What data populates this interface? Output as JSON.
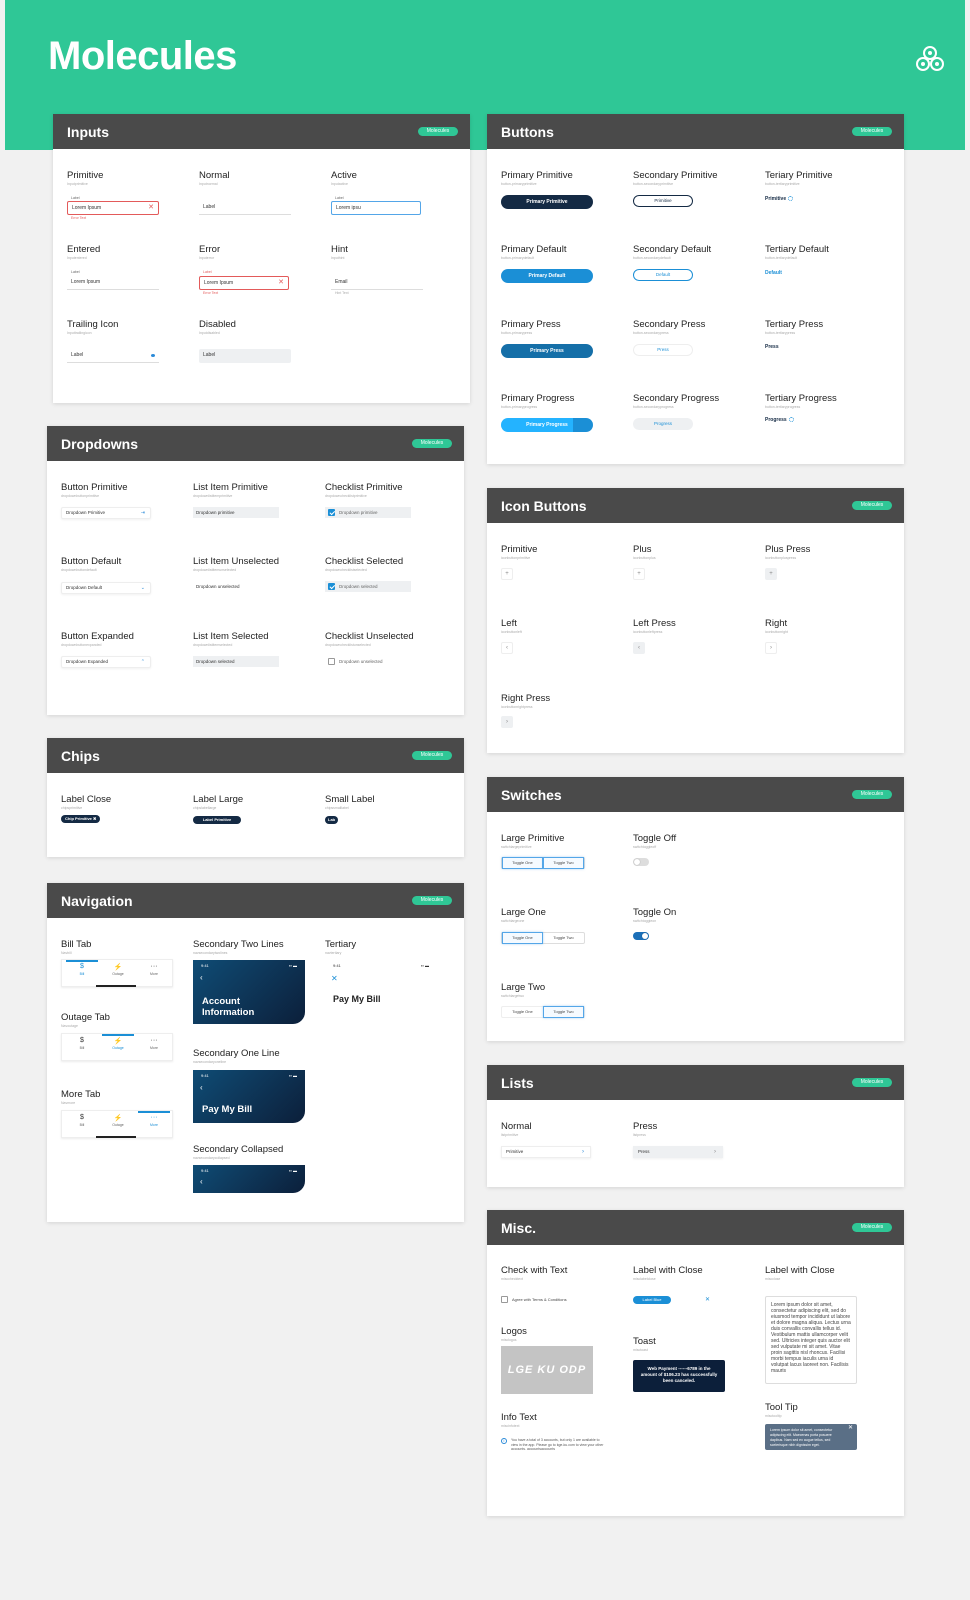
{
  "header": {
    "title": "Molecules",
    "logo": "trefoil-logo-icon"
  },
  "badge": "Molecules",
  "inputs": {
    "title": "Inputs",
    "primitive": {
      "label": "Primitive",
      "sub": "Inputprimitive",
      "float": "Label",
      "value": "Lorem Ipsum",
      "helper": "Error Text"
    },
    "normal": {
      "label": "Normal",
      "sub": "Inputnormal",
      "value": "Label"
    },
    "active": {
      "label": "Active",
      "sub": "Inputactive",
      "float": "Label",
      "value": "Lorem ipsu"
    },
    "entered": {
      "label": "Entered",
      "sub": "Inputentered",
      "float": "Label",
      "value": "Lorem Ipsum"
    },
    "error": {
      "label": "Error",
      "sub": "Inputerror",
      "float": "Label",
      "value": "Lorem Ipsum",
      "helper": "Error Text"
    },
    "hint": {
      "label": "Hint",
      "sub": "Inputhint",
      "value": "Email",
      "helper": "Hint Text"
    },
    "trailing": {
      "label": "Trailing Icon",
      "sub": "Inputtrailingicon",
      "value": "Label"
    },
    "disabled": {
      "label": "Disabled",
      "sub": "Inputdisabled",
      "value": "Label"
    }
  },
  "buttons": {
    "title": "Buttons",
    "pp": {
      "label": "Primary Primitive",
      "sub": "button-primaryprimitive",
      "btn": "Primary Primitive"
    },
    "sp": {
      "label": "Secondary Primitive",
      "sub": "button-secondaryprimitive",
      "btn": "Primitive"
    },
    "tp": {
      "label": "Teriary Primitive",
      "sub": "button-tertiaryprimitive",
      "btn": "Primitive"
    },
    "pd": {
      "label": "Primary Default",
      "sub": "button-primarydefault",
      "btn": "Primary Default"
    },
    "sd": {
      "label": "Secondary Default",
      "sub": "button-secondarydefault",
      "btn": "Default"
    },
    "td": {
      "label": "Tertiary Default",
      "sub": "button-tertiarydefault",
      "btn": "Default"
    },
    "ppr": {
      "label": "Primary Press",
      "sub": "button-primarypress",
      "btn": "Primary Press"
    },
    "spr": {
      "label": "Secondary Press",
      "sub": "button-secondarypress",
      "btn": "Press"
    },
    "tpr": {
      "label": "Tertiary Press",
      "sub": "button-tertiarypress",
      "btn": "Press"
    },
    "pg": {
      "label": "Primary Progress",
      "sub": "button-primaryprogress",
      "btn": "Primary Progress"
    },
    "sg": {
      "label": "Secondary Progress",
      "sub": "button-secondaryprogress",
      "btn": "Progress"
    },
    "tg": {
      "label": "Tertiary Progress",
      "sub": "button-tertiaryprogress",
      "btn": "Progress"
    }
  },
  "dropdowns": {
    "title": "Dropdowns",
    "bp": {
      "label": "Button Primitive",
      "sub": "dropdownbuttonprimitive",
      "value": "Dropdown Primitive"
    },
    "lp": {
      "label": "List Item Primitive",
      "sub": "dropdownlistitemprimitive",
      "value": "Dropdown primitive"
    },
    "cp": {
      "label": "Checklist Primitive",
      "sub": "dropdownchecklistprimitive",
      "value": "Dropdown primitive"
    },
    "bd": {
      "label": "Button Default",
      "sub": "dropdownbuttondefault",
      "value": "Dropdown Default"
    },
    "lu": {
      "label": "List Item Unselected",
      "sub": "dropdownlistitemunselected",
      "value": "Dropdown unselected"
    },
    "cs": {
      "label": "Checklist Selected",
      "sub": "dropdownchecklistselected",
      "value": "Dropdown selected"
    },
    "be": {
      "label": "Button Expanded",
      "sub": "dropdownbuttonexpanded",
      "value": "Dropdown Expanded"
    },
    "ls": {
      "label": "List Item Selected",
      "sub": "dropdownlistitemselected",
      "value": "Dropdown selected"
    },
    "cu": {
      "label": "Checklist Unselected",
      "sub": "dropdownchecklistunselected",
      "value": "Dropdown unselected"
    }
  },
  "iconButtons": {
    "title": "Icon Buttons",
    "prim": {
      "label": "Primitive",
      "sub": "iconbuttonprimitive"
    },
    "plus": {
      "label": "Plus",
      "sub": "iconbuttonplus"
    },
    "plusp": {
      "label": "Plus Press",
      "sub": "iconbuttonpluspress"
    },
    "left": {
      "label": "Left",
      "sub": "iconbuttonleft"
    },
    "leftp": {
      "label": "Left Press",
      "sub": "iconbuttonleftpress"
    },
    "right": {
      "label": "Right",
      "sub": "iconbuttonright"
    },
    "rightp": {
      "label": "Right Press",
      "sub": "iconbuttonrightpress"
    }
  },
  "chips": {
    "title": "Chips",
    "lc": {
      "label": "Label Close",
      "sub": "chipsprimitive",
      "chip": "Chip Primitive"
    },
    "ll": {
      "label": "Label Large",
      "sub": "chipslabellarge",
      "chip": "Label Primitive"
    },
    "sl": {
      "label": "Small Label",
      "sub": "chipssmalllabel",
      "chip": "Lab"
    }
  },
  "switches": {
    "title": "Switches",
    "lp": {
      "label": "Large Primitive",
      "sub": "switchlargeprimitive"
    },
    "toff": {
      "label": "Toggle Off",
      "sub": "switchtoggleoff"
    },
    "lo": {
      "label": "Large One",
      "sub": "switchlargeone"
    },
    "ton": {
      "label": "Toggle On",
      "sub": "switchtoggleon"
    },
    "lt": {
      "label": "Large Two",
      "sub": "switchlargetwo"
    },
    "one": "Toggle One",
    "two": "Toggle Two"
  },
  "navigation": {
    "title": "Navigation",
    "bill": {
      "label": "Bill Tab",
      "sub": "Navbill"
    },
    "outage": {
      "label": "Outage Tab",
      "sub": "Navoutage"
    },
    "more": {
      "label": "More Tab",
      "sub": "Navmore"
    },
    "tabs": [
      "Bill",
      "Outage",
      "More"
    ],
    "s2": {
      "label": "Secondary Two Lines",
      "sub": "navsecondarytwolines",
      "title": "Account Information"
    },
    "s1": {
      "label": "Secondary One Line",
      "sub": "navsecondaryoneline",
      "title": "Pay My Bill"
    },
    "sc": {
      "label": "Secondary Collapsed",
      "sub": "navsecondarycollapsed"
    },
    "tert": {
      "label": "Tertiary",
      "sub": "navtertiary",
      "title": "Pay My Bill"
    },
    "time": "9:41"
  },
  "lists": {
    "title": "Lists",
    "normal": {
      "label": "Normal",
      "sub": "listprimitive",
      "value": "Primitive"
    },
    "press": {
      "label": "Press",
      "sub": "listpress",
      "value": "Press"
    }
  },
  "misc": {
    "title": "Misc.",
    "cwt": {
      "label": "Check with Text",
      "sub": "miscchecktext",
      "value": "Agree with Terms & Conditions"
    },
    "lwc": {
      "label": "Label with Close",
      "sub": "misclabelclose",
      "value": "Label Blue"
    },
    "lwc2": {
      "label": "Label with Close",
      "sub": "miscclose",
      "value": "Lorem ipsum dolor sit amet, consectetur adipiscing elit, sed do eiusmod tempor incididunt ut labore et dolore magna aliqua. Lectus urna duis convallis convallis tellus id. Vestibulum mattis ullamcorper velit sed. Ultricies integer quis auctor elit sed vulputate mi sit amet. Vitae proin sagittis nisl rhoncus. Facilisi morbi tempus iaculis urna id volutpat lacus laoreet non. Facilisis mauris"
    },
    "logos": {
      "label": "Logos",
      "sub": "misclogos",
      "value": "LGE KU ODP"
    },
    "toast": {
      "label": "Toast",
      "sub": "misctoast",
      "value": "Web Payment ------6789 in the amount of $106.23 has successfully been canceled."
    },
    "info": {
      "label": "Info Text",
      "sub": "miscinfotext",
      "value": "You have a total of 3 accounts, but only 1 are available to view in the app. Please go to kge-ku.com to view your other accounts. accountsaccounts"
    },
    "tip": {
      "label": "Tool Tip",
      "sub": "misctooltip",
      "value": "Lorem ipsum dolor sit amet, consectetur adipiscing elit. Maecenas porta posuere dapibus. Nam sed ex augue tellus, sed scelerisque nibh dignissim eget."
    }
  }
}
